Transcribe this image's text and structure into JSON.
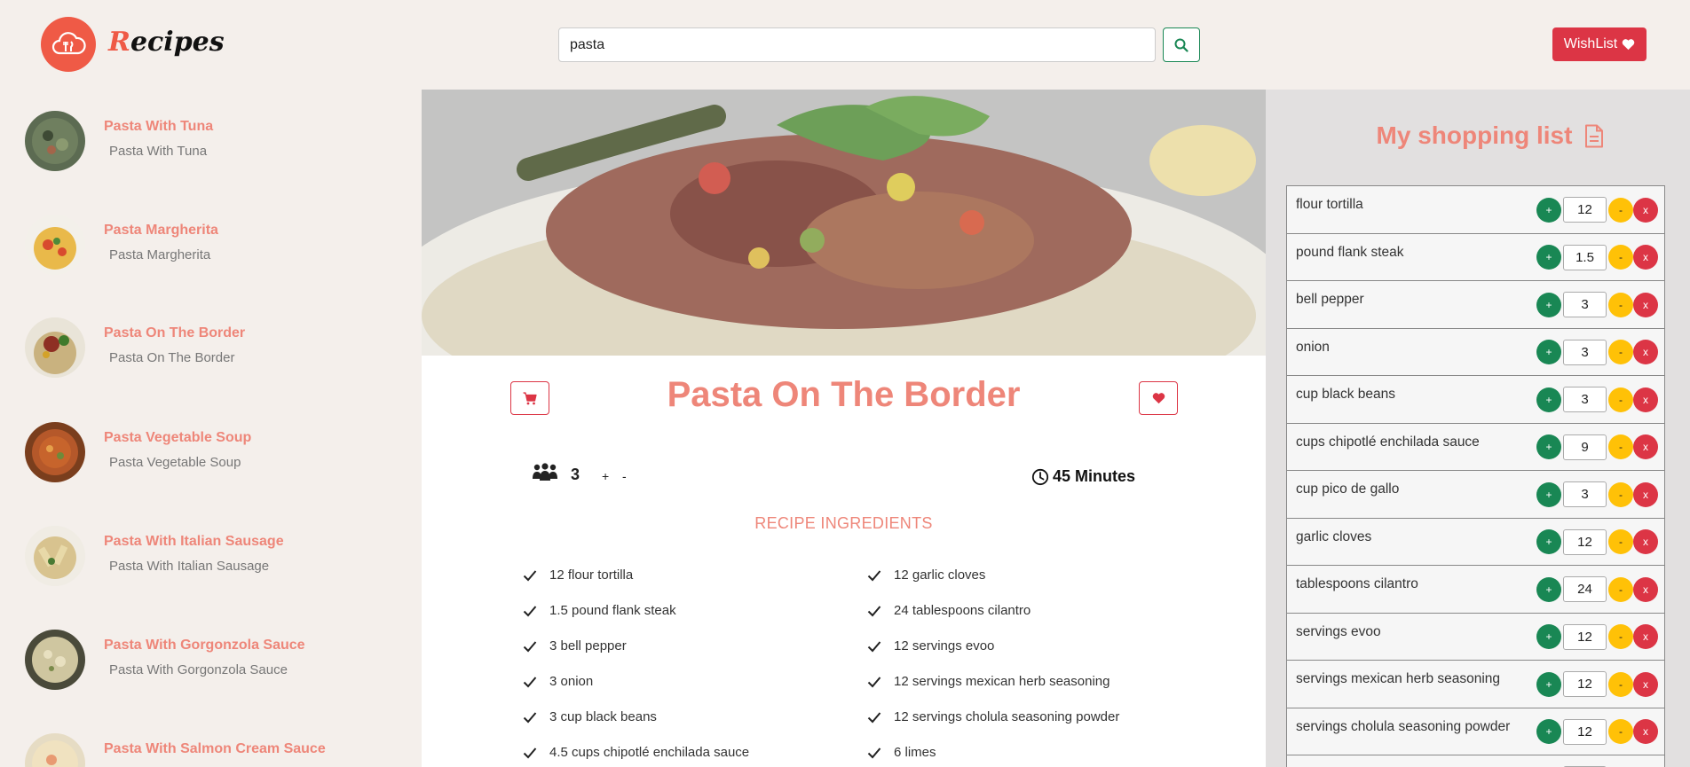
{
  "header": {
    "logo_text_first": "R",
    "logo_text_rest": "ecipes",
    "search_value": "pasta",
    "wishlist_label": "WishList"
  },
  "sidebar": {
    "items": [
      {
        "title": "Pasta With Tuna",
        "subtitle": "Pasta With Tuna"
      },
      {
        "title": "Pasta Margherita",
        "subtitle": "Pasta Margherita"
      },
      {
        "title": "Pasta On The Border",
        "subtitle": "Pasta On The Border"
      },
      {
        "title": "Pasta Vegetable Soup",
        "subtitle": "Pasta Vegetable Soup"
      },
      {
        "title": "Pasta With Italian Sausage",
        "subtitle": "Pasta With Italian Sausage"
      },
      {
        "title": "Pasta With Gorgonzola Sauce",
        "subtitle": "Pasta With Gorgonzola Sauce"
      },
      {
        "title": "Pasta With Salmon Cream Sauce",
        "subtitle": ""
      }
    ]
  },
  "recipe": {
    "title": "Pasta On The Border",
    "servings": "3",
    "servings_plus": "+",
    "servings_minus": "-",
    "time": "45 Minutes",
    "ingredients_heading": "RECIPE INGREDIENTS",
    "ingredients_left": [
      "12 flour tortilla",
      "1.5 pound flank steak",
      "3 bell pepper",
      "3 onion",
      "3 cup black beans",
      "4.5 cups chipotlé enchilada sauce"
    ],
    "ingredients_right": [
      "12 garlic cloves",
      "24 tablespoons cilantro",
      "12 servings evoo",
      "12 servings mexican herb seasoning",
      "12 servings cholula seasoning powder",
      "6 limes"
    ]
  },
  "shopping": {
    "title": "My shopping list",
    "plus_label": "+",
    "minus_label": "-",
    "remove_label": "x",
    "items": [
      {
        "name": "flour tortilla",
        "qty": "12"
      },
      {
        "name": "pound flank steak",
        "qty": "1.5"
      },
      {
        "name": "bell pepper",
        "qty": "3"
      },
      {
        "name": "onion",
        "qty": "3"
      },
      {
        "name": "cup black beans",
        "qty": "3"
      },
      {
        "name": "cups chipotlé enchilada sauce",
        "qty": "9"
      },
      {
        "name": "cup pico de gallo",
        "qty": "3"
      },
      {
        "name": "garlic cloves",
        "qty": "12"
      },
      {
        "name": "tablespoons cilantro",
        "qty": "24"
      },
      {
        "name": "servings evoo",
        "qty": "12"
      },
      {
        "name": "servings mexican herb seasoning",
        "qty": "12"
      },
      {
        "name": "servings cholula seasoning powder",
        "qty": "12"
      },
      {
        "name": "",
        "qty": ""
      }
    ]
  },
  "icons": {
    "logo": "cloud-fork-knife-icon",
    "search": "search-icon",
    "wishlist": "heart-icon",
    "cart": "cart-icon",
    "favorite": "heart-icon",
    "servings": "people-icon",
    "time": "clock-icon",
    "check": "check-icon",
    "shopping": "document-icon"
  },
  "colors": {
    "accent": "#ee8679",
    "brand": "#ef5a46",
    "danger": "#dc3545",
    "success": "#198754",
    "warning": "#ffc107",
    "background": "#f4efeb"
  }
}
